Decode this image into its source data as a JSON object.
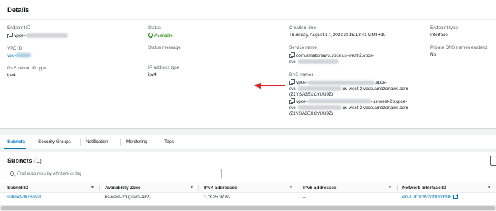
{
  "details": {
    "title": "Details",
    "endpoint_id": {
      "label": "Endpoint ID",
      "value": "vpce-"
    },
    "vpc_id": {
      "label": "VPC ID",
      "value": "vpc-"
    },
    "dns_record_ip_type": {
      "label": "DNS record IP type",
      "value": "ipv4"
    },
    "status": {
      "label": "Status",
      "value": "Available"
    },
    "status_message": {
      "label": "Status message",
      "value": "–"
    },
    "ip_address_type": {
      "label": "IP address type",
      "value": "ipv4"
    },
    "creation_time": {
      "label": "Creation time",
      "value": "Thursday, August 17, 2023 at 15:13:41 GMT+10"
    },
    "service_name": {
      "label": "Service name",
      "line1": "com.amazonaws.vpce.us-west-2.vpce-",
      "line2": "svc-"
    },
    "dns_names": {
      "label": "DNS names",
      "entry1": {
        "line1a": "vpce-",
        "line1b": ".vpce-",
        "line2a": "svc-",
        "line2b": ".us-west-2.vpce.amazonaws.com",
        "line3": "(Z1YSA3EXCYUU9Z)"
      },
      "entry2": {
        "line1a": "vpce-",
        "line1b": "-us-west-2b.vpce-",
        "line2a": "svc-",
        "line2b": ".us-west-2.vpce.amazonaws.com",
        "line3": "(Z1YSA3EXCYUU9Z)"
      }
    },
    "endpoint_type": {
      "label": "Endpoint type",
      "value": "Interface"
    },
    "private_dns": {
      "label": "Private DNS names enabled",
      "value": "No"
    }
  },
  "tabs": [
    "Subnets",
    "Security Groups",
    "Notification",
    "Monitoring",
    "Tags"
  ],
  "subnets": {
    "title": "Subnets",
    "count": "(1)",
    "search_placeholder": "Find resources by attribute or tag",
    "columns": [
      "Subnet ID",
      "Availability Zone",
      "IPv4 addresses",
      "IPv6 addresses",
      "Network Interface ID"
    ],
    "rows": [
      {
        "subnet_id": "subnet-db766fad",
        "az": "us-west-2b (usw2-az2)",
        "ipv4": "173.25.97.62",
        "ipv6": "–",
        "eni": "eni-07b3d992df10cdd98"
      }
    ]
  },
  "colors": {
    "link": "#0073bb",
    "success": "#1d8102",
    "arrow": "#e02424"
  },
  "icons": [
    "copy-icon",
    "check-circle-icon",
    "search-icon",
    "sort-icon",
    "external-link-icon",
    "red-arrow-annotation"
  ]
}
